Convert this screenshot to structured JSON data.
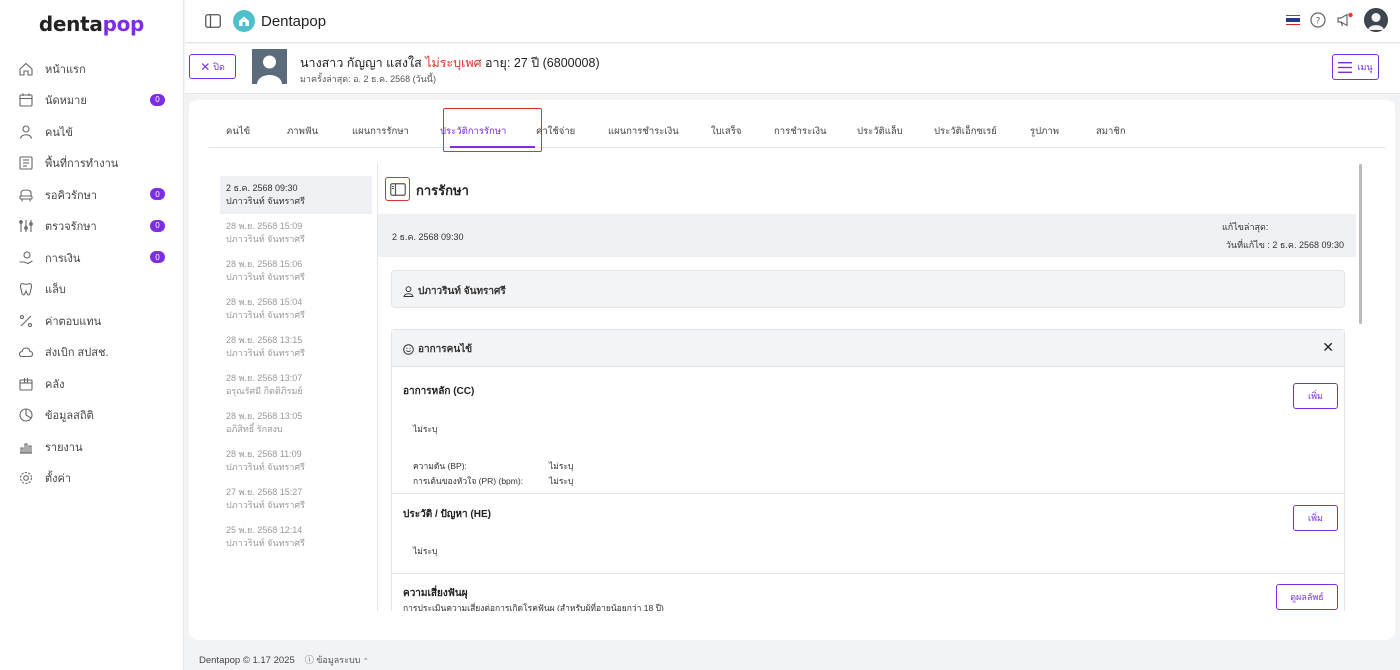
{
  "brand": {
    "logo_part1": "denta",
    "logo_part2": "pop",
    "app_name": "Dentapop"
  },
  "sidebar": {
    "items": [
      {
        "label": "หน้าแรก",
        "icon": "home-icon",
        "badge": ""
      },
      {
        "label": "นัดหมาย",
        "icon": "calendar-icon",
        "badge": "0"
      },
      {
        "label": "คนไข้",
        "icon": "user-icon",
        "badge": ""
      },
      {
        "label": "พื้นที่การทำงาน",
        "icon": "workspace-icon",
        "badge": ""
      },
      {
        "label": "รอคิวรักษา",
        "icon": "chair-icon",
        "badge": "0"
      },
      {
        "label": "ตรวจรักษา",
        "icon": "tools-icon",
        "badge": "0"
      },
      {
        "label": "การเงิน",
        "icon": "money-hand-icon",
        "badge": "0"
      },
      {
        "label": "แล็บ",
        "icon": "tooth-icon",
        "badge": ""
      },
      {
        "label": "ค่าตอบแทน",
        "icon": "percent-icon",
        "badge": ""
      },
      {
        "label": "ส่งเบิก สปสช.",
        "icon": "cloud-icon",
        "badge": ""
      },
      {
        "label": "คลัง",
        "icon": "box-icon",
        "badge": ""
      },
      {
        "label": "ข้อมูลสถิติ",
        "icon": "stats-icon",
        "badge": ""
      },
      {
        "label": "รายงาน",
        "icon": "report-icon",
        "badge": ""
      },
      {
        "label": "ตั้งค่า",
        "icon": "gear-icon",
        "badge": ""
      }
    ]
  },
  "patient": {
    "close_label": "ปิด",
    "name": "นางสาว กัญญา แสงใส",
    "sex": "ไม่ระบุเพศ",
    "age_label": "อายุ:",
    "age_value": "27 ปี",
    "hn": "(6800008)",
    "last_visit": "มาครั้งล่าสุด: อ. 2 ธ.ค. 2568 (วันนี้)",
    "menu_label": "เมนู"
  },
  "tabs": [
    {
      "label": "คนไข้"
    },
    {
      "label": "ภาพฟัน"
    },
    {
      "label": "แผนการรักษา"
    },
    {
      "label": "ประวัติการรักษา"
    },
    {
      "label": "ค่าใช้จ่าย"
    },
    {
      "label": "แผนการชำระเงิน"
    },
    {
      "label": "ใบเสร็จ"
    },
    {
      "label": "การชำระเงิน"
    },
    {
      "label": "ประวัติแล็บ"
    },
    {
      "label": "ประวัติเอ็กซเรย์"
    },
    {
      "label": "รูปภาพ"
    },
    {
      "label": "สมาชิก"
    }
  ],
  "visits": [
    {
      "date": "2 ธ.ค. 2568 09:30",
      "doctor": "ปภาวรินท์ จันทราศรี"
    },
    {
      "date": "28 พ.ย. 2568 15:09",
      "doctor": "ปภาวรินท์ จันทราศรี"
    },
    {
      "date": "28 พ.ย. 2568 15:06",
      "doctor": "ปภาวรินท์ จันทราศรี"
    },
    {
      "date": "28 พ.ย. 2568 15:04",
      "doctor": "ปภาวรินท์ จันทราศรี"
    },
    {
      "date": "28 พ.ย. 2568 13:15",
      "doctor": "ปภาวรินท์ จันทราศรี"
    },
    {
      "date": "28 พ.ย. 2568 13:07",
      "doctor": "อรุณรัศมี กิตติภิรมย์"
    },
    {
      "date": "28 พ.ย. 2568 13:05",
      "doctor": "อภิสิทธิ์ รักสงบ"
    },
    {
      "date": "28 พ.ย. 2568 11:09",
      "doctor": "ปภาวรินท์ จันทราศรี"
    },
    {
      "date": "27 พ.ย. 2568 15:27",
      "doctor": "ปภาวรินท์ จันทราศรี"
    },
    {
      "date": "25 พ.ย. 2568 12:14",
      "doctor": "ปภาวรินท์ จันทราศรี"
    }
  ],
  "detail": {
    "title": "การรักษา",
    "date": "2 ธ.ค. 2568 09:30",
    "last_edit_label": "แก้ไขล่าสุด:",
    "edit_date": "วันที่แก้ไข : 2 ธ.ค. 2568 09:30",
    "doctor": "ปภาวรินท์ จันทราศรี",
    "symptoms_title": "อาการคนไข้",
    "cc_title": "อาการหลัก (CC)",
    "cc_value": "ไม่ระบุ",
    "bp_label": "ความดัน (BP):",
    "bp_value": "ไม่ระบุ",
    "pr_label": "การเต้นของหัวใจ (PR) (bpm):",
    "pr_value": "ไม่ระบุ",
    "he_title": "ประวัติ / ปัญหา (HE)",
    "he_value": "ไม่ระบุ",
    "risk_title": "ความเสี่ยงฟันผุ",
    "risk_sub": "การประเมินความเสี่ยงต่อการเกิดโรคฟันผุ (สำหรับผู้ที่อายุน้อยกว่า 18 ปี)",
    "add_label": "เพิ่ม",
    "view_result_label": "ดูผลลัพธ์"
  },
  "footer": {
    "copyright": "Dentapop © 1.17 2025",
    "system_info": "ข้อมูลระบบ"
  },
  "colors": {
    "accent": "#7b2fe0",
    "danger": "#dd3333",
    "brand_teal": "#4ec0c9"
  }
}
